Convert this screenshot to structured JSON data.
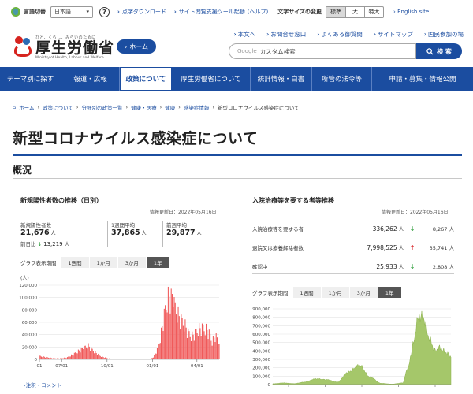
{
  "utility": {
    "lang_label": "言語切替",
    "lang_value": "日本語",
    "help": "?",
    "download_link": "点字ダウンロード",
    "tool_link": "サイト閲覧支援ツール起動",
    "tool_help": "(ヘルプ)",
    "font_size_label": "文字サイズの変更",
    "font_sizes": [
      "標準",
      "大",
      "特大"
    ],
    "english": "English site"
  },
  "header": {
    "logo_tagline": "ひと、くらし、みらいのために",
    "logo_name": "厚生労働省",
    "logo_en": "Ministry of Health, Labour and Welfare",
    "home": "ホーム",
    "sublinks": [
      "本文へ",
      "お問合せ窓口",
      "よくある御質問",
      "サイトマップ",
      "国民参加の場"
    ],
    "search_prefix": "Google",
    "search_placeholder": "カスタム検索",
    "search_button": "検 索"
  },
  "nav": {
    "items": [
      "テーマ別に探す",
      "報道・広報",
      "政策について",
      "厚生労働省について",
      "統計情報・白書",
      "所管の法令等",
      "申請・募集・情報公開"
    ],
    "active_index": 2
  },
  "breadcrumb": [
    "ホーム",
    "政策について",
    "分野別の政策一覧",
    "健康・医療",
    "健康",
    "感染症情報",
    "新型コロナウイルス感染症について"
  ],
  "page": {
    "title": "新型コロナウイルス感染症について",
    "section": "概況"
  },
  "left_panel": {
    "title": "新規陽性者数の推移（日別）",
    "updated": "情報更新日：2022年05月16日",
    "stat1_label": "新規陽性者数",
    "stat1_value": "21,676",
    "unit": "人",
    "prev_label": "前日比",
    "prev_arrow": "↓",
    "prev_value": "13,219",
    "stat2_label": "1週間平均",
    "stat2_value": "37,865",
    "stat3_label": "前週平均",
    "stat3_value": "29,877",
    "period_label": "グラフ表示期間",
    "periods": [
      "1週間",
      "1か月",
      "3か月",
      "1年"
    ],
    "selected_period": 3,
    "note": "注釈・コメント"
  },
  "right_panel": {
    "title": "入院治療等を要する者等推移",
    "updated": "情報更新日：2022年05月16日",
    "rows": [
      {
        "label": "入院治療等を要する者",
        "value": "336,262",
        "unit": "人",
        "arrow": "↓",
        "arrow_color": "#2e9e3c",
        "change": "8,267",
        "change_unit": "人"
      },
      {
        "label": "退院又は療養解除者数",
        "value": "7,998,525",
        "unit": "人",
        "arrow": "↑",
        "arrow_color": "#d8282b",
        "change": "35,741",
        "change_unit": "人"
      },
      {
        "label": "確認中",
        "value": "25,933",
        "unit": "人",
        "arrow": "↓",
        "arrow_color": "#2e9e3c",
        "change": "2,808",
        "change_unit": "人"
      }
    ],
    "period_label": "グラフ表示期間",
    "periods": [
      "1週間",
      "1か月",
      "3か月",
      "1年"
    ],
    "selected_period": 3
  },
  "colors": {
    "brand": "#1b4da0",
    "positive_bar": "#f05a5a",
    "hospital_area": "#a5c76a"
  },
  "chart_data": [
    {
      "type": "bar",
      "unit_label": "(人)",
      "ylim": [
        0,
        120000
      ],
      "y_ticks": [
        "0",
        "20,000",
        "40,000",
        "60,000",
        "80,000",
        "100,000",
        "120,000"
      ],
      "x_ticks": [
        "01",
        "07/01",
        "10/01",
        "01/01",
        "04/01"
      ],
      "color": "#f05a5a",
      "x": [
        "2021-05-17",
        "2021-05-31",
        "2021-06-14",
        "2021-06-28",
        "2021-07-12",
        "2021-07-26",
        "2021-08-09",
        "2021-08-23",
        "2021-09-06",
        "2021-09-20",
        "2021-10-04",
        "2021-10-18",
        "2021-11-01",
        "2021-11-15",
        "2021-11-29",
        "2021-12-13",
        "2021-12-27",
        "2022-01-03",
        "2022-01-10",
        "2022-01-17",
        "2022-01-24",
        "2022-01-31",
        "2022-02-07",
        "2022-02-14",
        "2022-02-21",
        "2022-02-28",
        "2022-03-07",
        "2022-03-14",
        "2022-03-21",
        "2022-03-28",
        "2022-04-04",
        "2022-04-11",
        "2022-04-18",
        "2022-04-25",
        "2022-05-02",
        "2022-05-09",
        "2022-05-16"
      ],
      "values": [
        5500,
        3500,
        1800,
        1600,
        3000,
        9000,
        16000,
        23000,
        12000,
        4500,
        1500,
        500,
        250,
        150,
        120,
        180,
        400,
        4000,
        15000,
        35000,
        70000,
        98000,
        104000,
        90000,
        74000,
        65000,
        57000,
        45000,
        37000,
        43000,
        49000,
        52000,
        50000,
        45000,
        28000,
        41000,
        21676
      ]
    },
    {
      "type": "area",
      "ylim": [
        0,
        900000
      ],
      "y_ticks": [
        "0",
        "100,000",
        "200,000",
        "300,000",
        "400,000",
        "500,000",
        "600,000",
        "700,000",
        "800,000",
        "900,000"
      ],
      "color": "#a5c76a",
      "x": [
        "2021-01-01",
        "2021-02-01",
        "2021-03-01",
        "2021-04-01",
        "2021-05-01",
        "2021-06-01",
        "2021-07-01",
        "2021-08-01",
        "2021-09-01",
        "2021-10-01",
        "2021-11-01",
        "2021-12-01",
        "2022-01-01",
        "2022-01-15",
        "2022-02-01",
        "2022-02-10",
        "2022-02-20",
        "2022-03-01",
        "2022-03-15",
        "2022-04-01",
        "2022-04-15",
        "2022-05-01",
        "2022-05-16"
      ],
      "values": [
        10000,
        20000,
        12000,
        30000,
        70000,
        60000,
        30000,
        150000,
        230000,
        90000,
        15000,
        6000,
        20000,
        200000,
        500000,
        760000,
        820000,
        780000,
        560000,
        400000,
        440000,
        380000,
        336262
      ]
    }
  ]
}
